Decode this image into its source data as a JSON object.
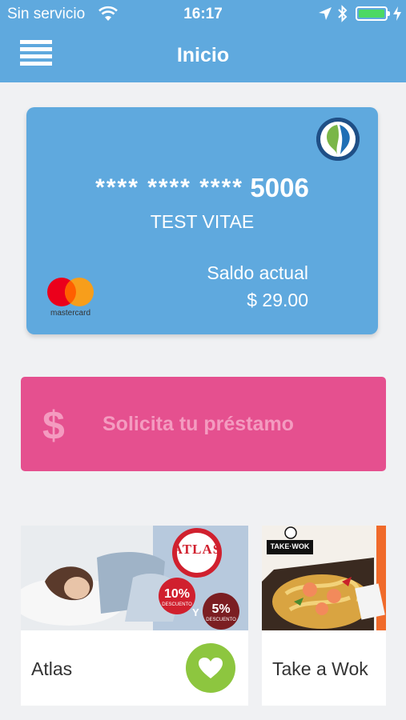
{
  "status_bar": {
    "carrier": "Sin servicio",
    "time": "16:17"
  },
  "nav": {
    "title": "Inicio",
    "menu_icon": "hamburger-menu-icon"
  },
  "card": {
    "masked_digits": "**** **** ****",
    "last_digits": "5006",
    "holder": "TEST VITAE",
    "balance_label": "Saldo actual",
    "balance_value": "$ 29.00",
    "network_text": "mastercard",
    "color": "#5fa9de"
  },
  "loan": {
    "icon": "dollar-icon",
    "label": "Solicita tu préstamo",
    "symbol": "$",
    "color": "#e5508f"
  },
  "promos": [
    {
      "name": "Atlas",
      "logo_text": "ATLAS",
      "discount_1": "10%",
      "discount_2": "5%",
      "discount_word": "DESCUENTO",
      "joiner": "Y",
      "favorite_color": "#8dc63f"
    },
    {
      "name": "Take a Wok",
      "logo_text": "TAKE·WOK"
    }
  ]
}
